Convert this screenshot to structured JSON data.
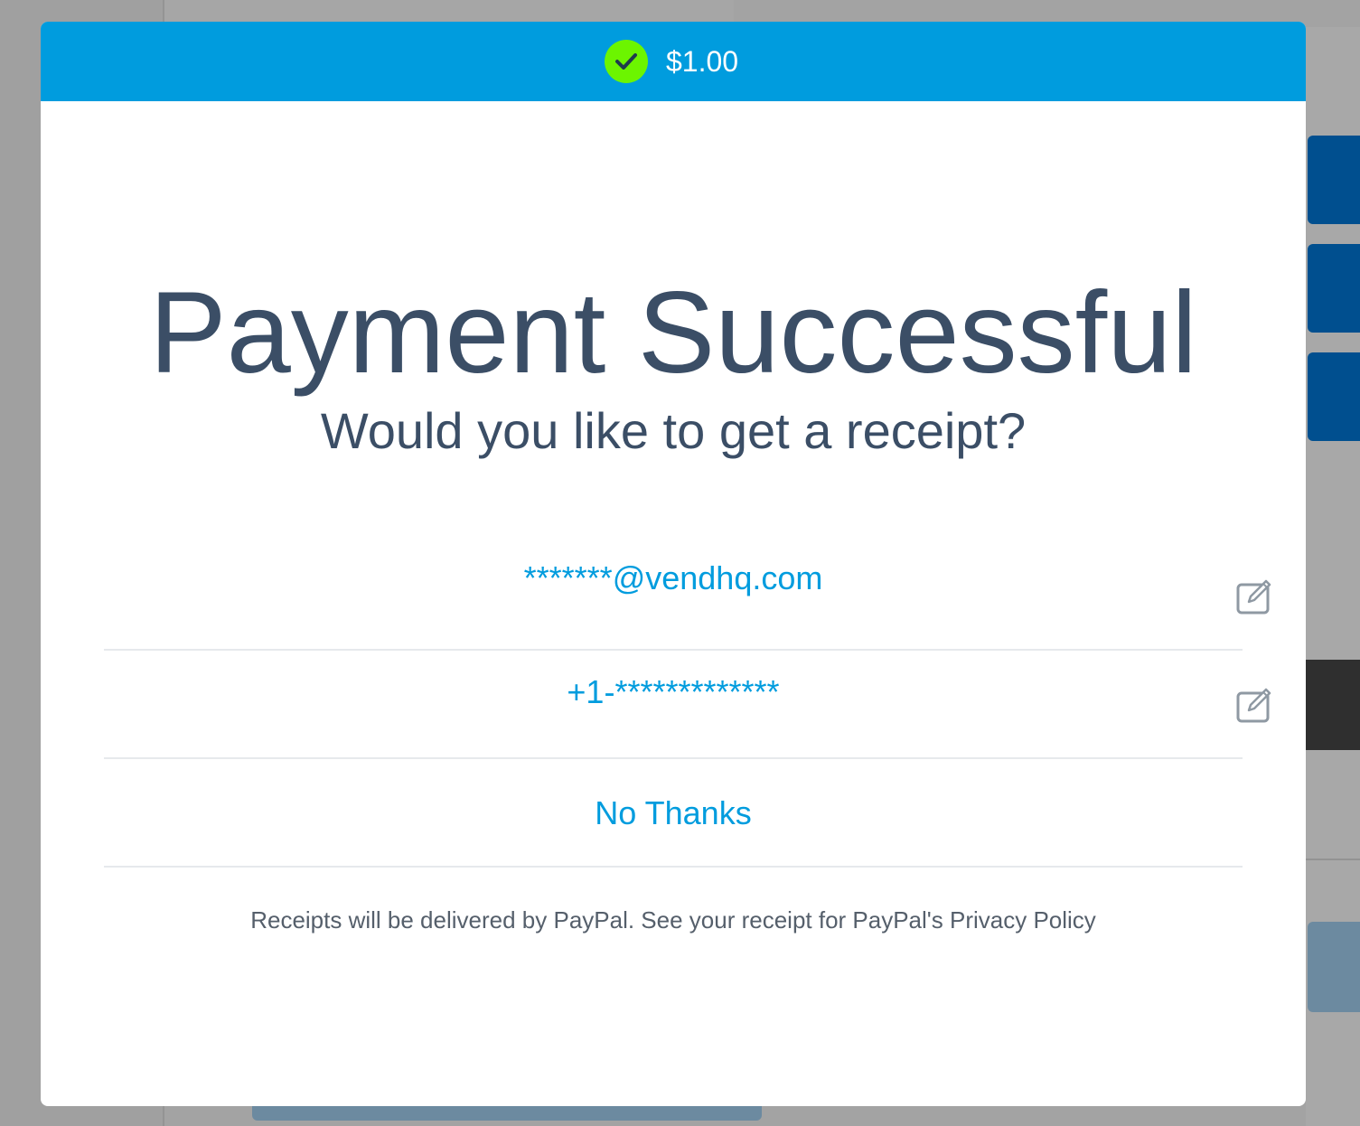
{
  "header": {
    "amount": "$1.00",
    "status_icon": "check-circle-icon",
    "color": "#009cde",
    "badge_color": "#6cf500"
  },
  "main": {
    "title": "Payment Successful",
    "subtitle": "Would you like to get a receipt?"
  },
  "receipt_options": {
    "email": "*******@vendhq.com",
    "phone": "+1-*************",
    "decline": "No Thanks",
    "edit_icon": "edit-icon"
  },
  "footer": {
    "note": "Receipts will be delivered by PayPal. See your receipt for PayPal's Privacy Policy"
  },
  "colors": {
    "text_dark": "#3b4e66",
    "link": "#009cde",
    "backdrop": "#a3a3a3"
  }
}
